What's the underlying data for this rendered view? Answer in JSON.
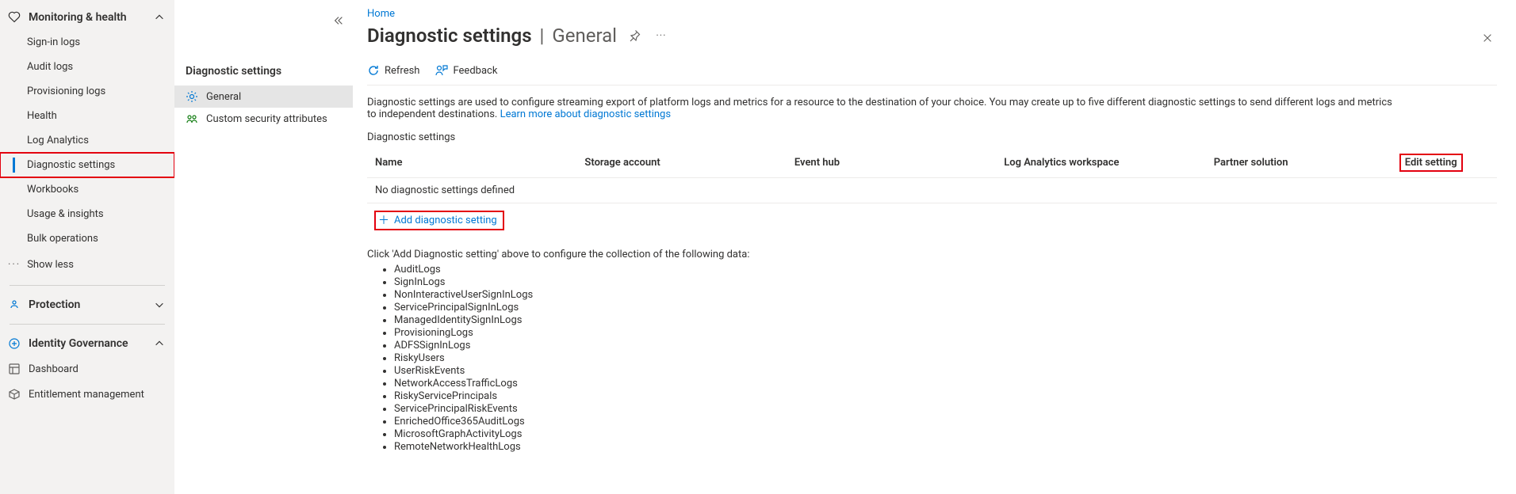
{
  "breadcrumb": {
    "home": "Home"
  },
  "title": {
    "main": "Diagnostic settings",
    "sub": "General"
  },
  "leftnav": {
    "group_monitoring": "Monitoring & health",
    "signin_logs": "Sign-in logs",
    "audit_logs": "Audit logs",
    "provisioning_logs": "Provisioning logs",
    "health": "Health",
    "log_analytics": "Log Analytics",
    "diagnostic_settings": "Diagnostic settings",
    "workbooks": "Workbooks",
    "usage_insights": "Usage & insights",
    "bulk_operations": "Bulk operations",
    "show_less": "Show less",
    "group_protection": "Protection",
    "group_identity_gov": "Identity Governance",
    "dashboard": "Dashboard",
    "entitlement_mgmt": "Entitlement management"
  },
  "blade_menu": {
    "header": "Diagnostic settings",
    "general": "General",
    "custom_security": "Custom security attributes"
  },
  "commands": {
    "refresh": "Refresh",
    "feedback": "Feedback"
  },
  "blurb": {
    "text": "Diagnostic settings are used to configure streaming export of platform logs and metrics for a resource to the destination of your choice. You may create up to five different diagnostic settings to send different logs and metrics to independent destinations. ",
    "link": "Learn more about diagnostic settings"
  },
  "section_title": "Diagnostic settings",
  "table": {
    "col_name": "Name",
    "col_storage": "Storage account",
    "col_eventhub": "Event hub",
    "col_law": "Log Analytics workspace",
    "col_partner": "Partner solution",
    "col_edit": "Edit setting",
    "empty": "No diagnostic settings defined",
    "add": "Add diagnostic setting"
  },
  "hint": "Click 'Add Diagnostic setting' above to configure the collection of the following data:",
  "data_types": [
    "AuditLogs",
    "SignInLogs",
    "NonInteractiveUserSignInLogs",
    "ServicePrincipalSignInLogs",
    "ManagedIdentitySignInLogs",
    "ProvisioningLogs",
    "ADFSSignInLogs",
    "RiskyUsers",
    "UserRiskEvents",
    "NetworkAccessTrafficLogs",
    "RiskyServicePrincipals",
    "ServicePrincipalRiskEvents",
    "EnrichedOffice365AuditLogs",
    "MicrosoftGraphActivityLogs",
    "RemoteNetworkHealthLogs"
  ]
}
